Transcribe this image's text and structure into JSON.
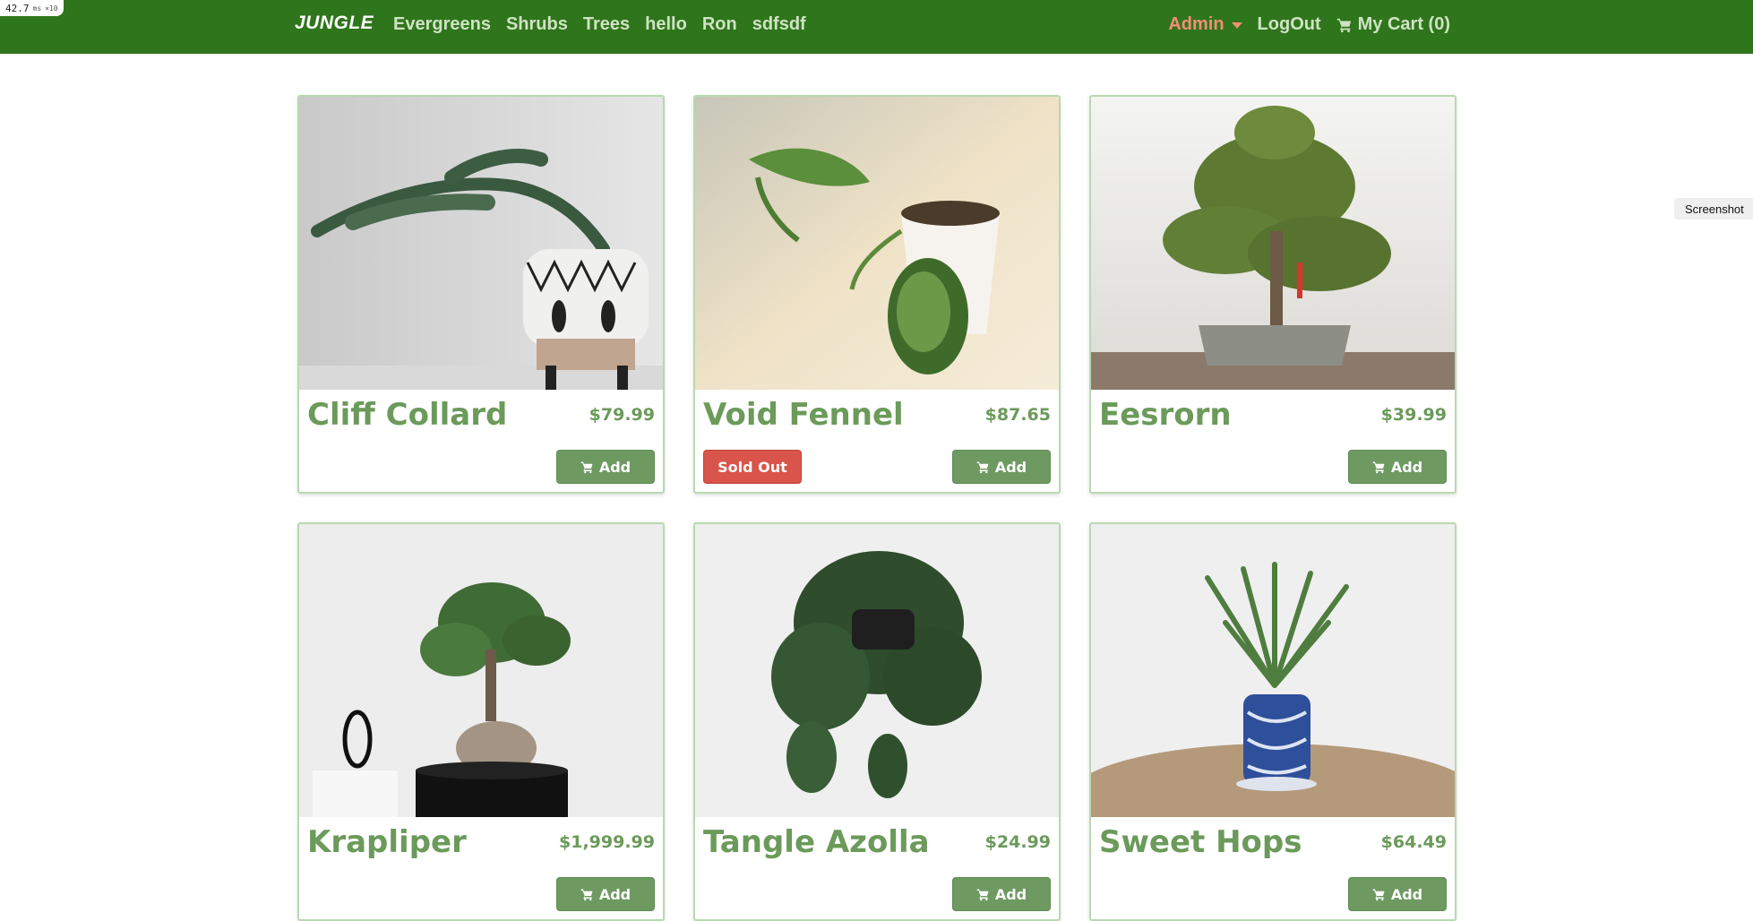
{
  "debug": {
    "timing": "42.7",
    "unit": "ms",
    "multiplier": "×10"
  },
  "nav": {
    "brand": "JUNGLE",
    "categories": [
      {
        "label": "Evergreens"
      },
      {
        "label": "Shrubs"
      },
      {
        "label": "Trees"
      },
      {
        "label": "hello"
      },
      {
        "label": "Ron"
      },
      {
        "label": "sdfsdf"
      }
    ],
    "admin_label": "Admin",
    "logout_label": "LogOut",
    "cart_label": "My Cart (0)"
  },
  "screenshot_tab": {
    "label": "Screenshot"
  },
  "colors": {
    "navbar": "#2f751b",
    "accent_green": "#6b9a5a",
    "button_green": "#6e9a62",
    "sold_out_red": "#d9544a",
    "admin_orange": "#f28e73",
    "card_border": "#b8d9b0"
  },
  "products": [
    {
      "name": "Cliff Collard",
      "price": "$79.99",
      "add_label": "Add",
      "sold_out": false,
      "image": "juniper-bonsai-in-patterned-pot"
    },
    {
      "name": "Void Fennel",
      "price": "$87.65",
      "add_label": "Add",
      "sold_out": true,
      "sold_out_label": "Sold Out",
      "image": "pothos-cutting-with-white-pot"
    },
    {
      "name": "Eesrorn",
      "price": "$39.99",
      "add_label": "Add",
      "sold_out": false,
      "image": "bonsai-tree-on-wood"
    },
    {
      "name": "Krapliper",
      "price": "$1,999.99",
      "add_label": "Add",
      "sold_out": false,
      "image": "ficus-bonsai-black-pot"
    },
    {
      "name": "Tangle Azolla",
      "price": "$24.99",
      "add_label": "Add",
      "sold_out": false,
      "image": "hanging-philodendron"
    },
    {
      "name": "Sweet Hops",
      "price": "$64.49",
      "add_label": "Add",
      "sold_out": false,
      "image": "palm-in-blue-white-pot"
    }
  ]
}
